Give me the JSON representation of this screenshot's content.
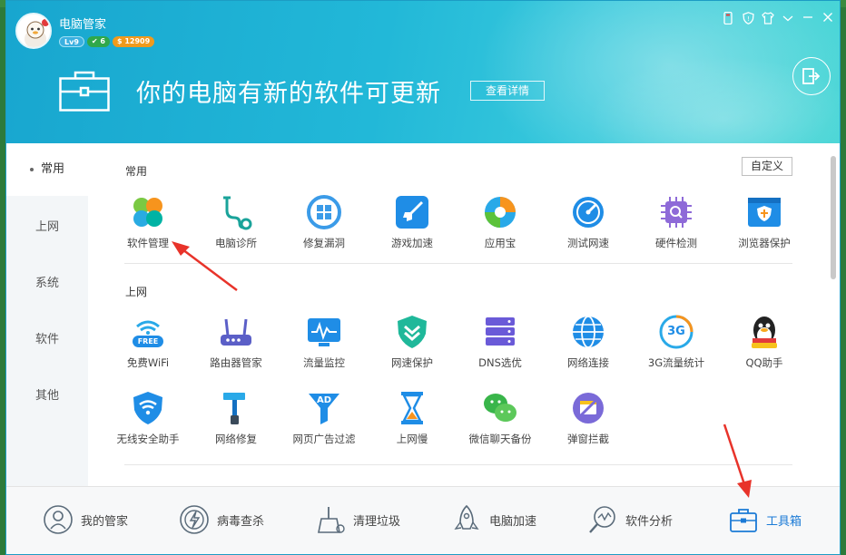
{
  "header": {
    "app_title": "电脑管家",
    "level_badge": "Lv9",
    "vip_badge": "6",
    "coin_badge": "12909",
    "banner_text": "你的电脑有新的软件可更新",
    "detail_button": "查看详情"
  },
  "sidebar": {
    "items": [
      {
        "label": "常用"
      },
      {
        "label": "上网"
      },
      {
        "label": "系统"
      },
      {
        "label": "软件"
      },
      {
        "label": "其他"
      }
    ]
  },
  "content": {
    "customize_button": "自定义",
    "sections": [
      {
        "title": "常用",
        "tools": [
          {
            "label": "软件管理",
            "icon": "clover-icon"
          },
          {
            "label": "电脑诊所",
            "icon": "stethoscope-icon"
          },
          {
            "label": "修复漏洞",
            "icon": "windows-repair-icon"
          },
          {
            "label": "游戏加速",
            "icon": "game-rocket-icon"
          },
          {
            "label": "应用宝",
            "icon": "app-store-icon"
          },
          {
            "label": "测试网速",
            "icon": "speedometer-icon"
          },
          {
            "label": "硬件检测",
            "icon": "chip-icon"
          },
          {
            "label": "浏览器保护",
            "icon": "browser-shield-icon"
          }
        ]
      },
      {
        "title": "上网",
        "tools": [
          {
            "label": "免费WiFi",
            "icon": "free-wifi-icon",
            "badge": "FREE"
          },
          {
            "label": "路由器管家",
            "icon": "router-icon"
          },
          {
            "label": "流量监控",
            "icon": "traffic-monitor-icon"
          },
          {
            "label": "网速保护",
            "icon": "speed-shield-icon"
          },
          {
            "label": "DNS选优",
            "icon": "dns-server-icon"
          },
          {
            "label": "网络连接",
            "icon": "globe-icon"
          },
          {
            "label": "3G流量统计",
            "icon": "3g-icon",
            "badge": "3G"
          },
          {
            "label": "QQ助手",
            "icon": "qq-penguin-icon"
          },
          {
            "label": "无线安全助手",
            "icon": "wifi-shield-icon"
          },
          {
            "label": "网络修复",
            "icon": "hammer-icon"
          },
          {
            "label": "网页广告过滤",
            "icon": "ad-filter-icon",
            "badge": "AD"
          },
          {
            "label": "上网慢",
            "icon": "hourglass-icon"
          },
          {
            "label": "微信聊天备份",
            "icon": "wechat-icon"
          },
          {
            "label": "弹窗拦截",
            "icon": "popup-block-icon"
          }
        ]
      }
    ]
  },
  "bottom_nav": [
    {
      "label": "我的管家",
      "icon": "butler-icon"
    },
    {
      "label": "病毒查杀",
      "icon": "virus-kill-icon"
    },
    {
      "label": "清理垃圾",
      "icon": "cleanup-icon"
    },
    {
      "label": "电脑加速",
      "icon": "rocket-icon"
    },
    {
      "label": "软件分析",
      "icon": "software-analysis-icon"
    },
    {
      "label": "工具箱",
      "icon": "toolbox-icon",
      "active": true
    }
  ],
  "colors": {
    "header_start": "#18a6cf",
    "header_end": "#4ad6d6",
    "active_nav": "#1b7ad6",
    "annotation_arrow": "#e8332a"
  }
}
